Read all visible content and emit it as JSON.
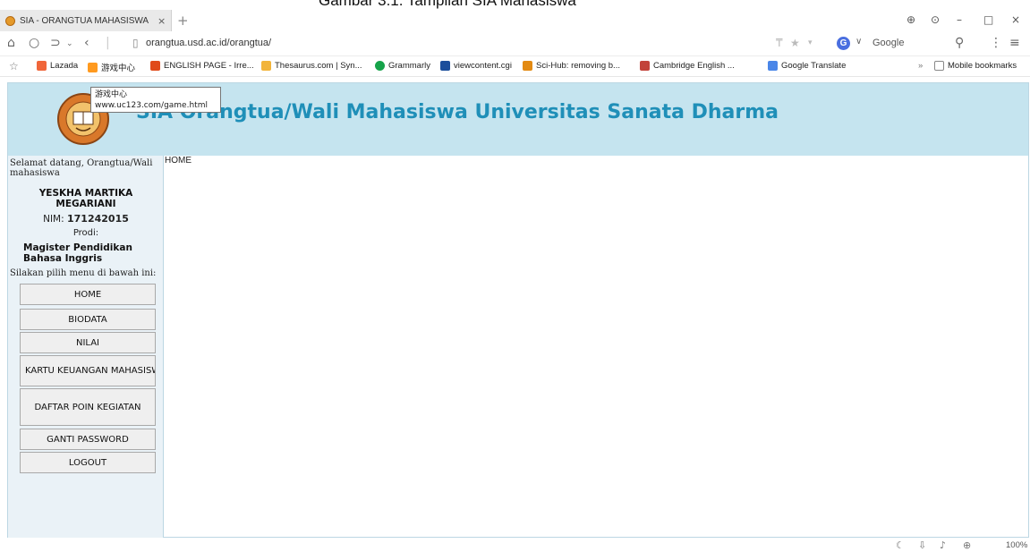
{
  "caption": "Gambar 3.1. Tampilan SIA Mahasiswa",
  "browser": {
    "tab_title": "SIA - ORANGTUA MAHASISWA",
    "tab_close": "×",
    "new_tab": "+",
    "url": "orangtua.usd.ac.id/orangtua/",
    "search_engine": "Google",
    "search_badge": "G",
    "window_controls": [
      "⊕",
      "⊙",
      "–",
      "□",
      "×"
    ],
    "bookmarks": [
      {
        "label": "Lazada",
        "color": "#f0663a"
      },
      {
        "label": "游戏中心",
        "color": "#ff9a1f"
      },
      {
        "label": "ENGLISH PAGE - Irre...",
        "color": "#e04a1a"
      },
      {
        "label": "Thesaurus.com | Syn...",
        "color": "#f2b43a"
      },
      {
        "label": "Grammarly",
        "color": "#16a34a"
      },
      {
        "label": "viewcontent.cgi",
        "color": "#1b4e9b"
      },
      {
        "label": "Sci-Hub: removing b...",
        "color": "#e38a12"
      },
      {
        "label": "Cambridge English ...",
        "color": "#c2433a"
      },
      {
        "label": "Google Translate",
        "color": "#4a86e8"
      }
    ],
    "bookmarks_overflow": "»",
    "mobile_bookmarks": "Mobile bookmarks",
    "zoom_level": "100%"
  },
  "tooltip": {
    "line1": "游戏中心",
    "line2": "www.uc123.com/game.html"
  },
  "site": {
    "title": "SIA Orangtua/Wali Mahasiswa Universitas Sanata Dharma",
    "accent_color": "#1f8fb8",
    "header_bg": "#c5e4ef"
  },
  "sidebar": {
    "welcome": "Selamat datang, Orangtua/Wali mahasiswa",
    "student_name": "YESKHA MARTIKA MEGARIANI",
    "nim_label": "NIM:",
    "nim": "171242015",
    "prodi_label": "Prodi:",
    "prodi": "Magister Pendidikan Bahasa Inggris",
    "menu_hint": "Silakan pilih menu di bawah ini:",
    "menu": [
      "HOME",
      "BIODATA",
      "NILAI",
      "KARTU KEUANGAN MAHASISWA",
      "DAFTAR POIN KEGIATAN",
      "GANTI PASSWORD",
      "LOGOUT"
    ]
  },
  "content": {
    "breadcrumb": "HOME"
  }
}
